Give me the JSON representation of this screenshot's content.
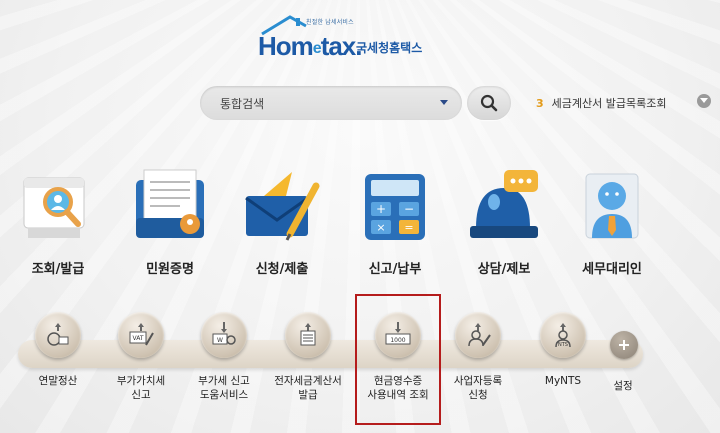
{
  "logo": {
    "tagline": "친절한 납세서비스",
    "brand_prefix": "Hom",
    "brand_e": "e",
    "brand_suffix": "tax.",
    "brand_korean": "국세청홈택스"
  },
  "search": {
    "selected_option": "통합검색",
    "button_icon": "magnifier-icon"
  },
  "ticker": {
    "number": "3",
    "text": "세금계산서 발급목록조회"
  },
  "main_menu": [
    {
      "label": "조회/발급",
      "icon": "search-document-icon"
    },
    {
      "label": "민원증명",
      "icon": "certificate-document-icon"
    },
    {
      "label": "신청/제출",
      "icon": "envelope-pen-icon"
    },
    {
      "label": "신고/납부",
      "icon": "calculator-icon"
    },
    {
      "label": "상담/제보",
      "icon": "chat-siren-icon"
    },
    {
      "label": "세무대리인",
      "icon": "agent-person-icon"
    }
  ],
  "quick_menu": [
    {
      "label": "연말정산",
      "icon": "year-end-settlement-icon"
    },
    {
      "label": "부가가치세\n신고",
      "icon": "vat-icon"
    },
    {
      "label": "부가세 신고\n도움서비스",
      "icon": "vat-help-icon"
    },
    {
      "label": "전자세금계산서\n발급",
      "icon": "e-tax-invoice-icon"
    },
    {
      "label": "현금영수증\n사용내역 조회",
      "icon": "cash-receipt-icon"
    },
    {
      "label": "사업자등록\n신청",
      "icon": "business-registration-icon"
    },
    {
      "label": "MyNTS",
      "icon": "mynts-icon"
    }
  ],
  "settings_label": "설정",
  "colors": {
    "brand_blue": "#1d5aa6",
    "highlight_red": "#b51c1c",
    "ticker_number": "#e39b1a"
  }
}
